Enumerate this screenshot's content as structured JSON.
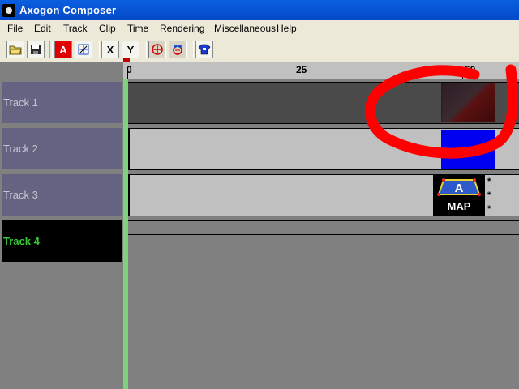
{
  "window": {
    "title": "Axogon Composer",
    "icon": "app-icon"
  },
  "menu": [
    "File",
    "Edit",
    "Track",
    "Clip",
    "Time",
    "Rendering",
    "Miscellaneous",
    "Help"
  ],
  "toolbar": {
    "buttons": [
      {
        "name": "open-folder-icon",
        "glyph": "📂"
      },
      {
        "name": "save-icon",
        "glyph": "💾"
      },
      {
        "name": "text-a-icon",
        "glyph": "A"
      },
      {
        "name": "transform-icon",
        "glyph": "⊞"
      },
      {
        "name": "x-axis-icon",
        "glyph": "X"
      },
      {
        "name": "y-axis-icon",
        "glyph": "Y"
      },
      {
        "name": "crosshair-icon",
        "glyph": "⊕"
      },
      {
        "name": "nodes-icon",
        "glyph": "⚙"
      },
      {
        "name": "tshirt-icon",
        "glyph": "👕"
      }
    ]
  },
  "ruler": {
    "labels": [
      "0",
      "25",
      "50"
    ]
  },
  "tracks": [
    {
      "label": "Track 1"
    },
    {
      "label": "Track 2"
    },
    {
      "label": "Track 3"
    },
    {
      "label": "Track 4"
    }
  ],
  "clips": {
    "track3_map": {
      "letter": "A",
      "label": "MAP",
      "stars": [
        "*",
        "*",
        "*"
      ]
    }
  },
  "colors": {
    "annotation": "#ff0000",
    "selected_track_text": "#33cc33",
    "track_panel": "#646482",
    "clip_blue": "#0000f0"
  }
}
